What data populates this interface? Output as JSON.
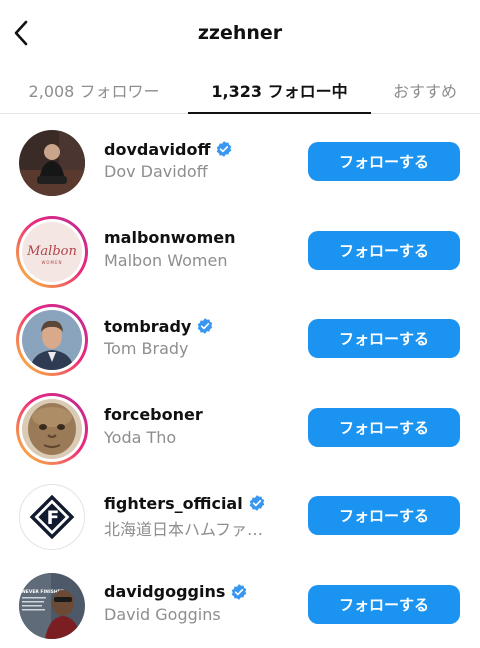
{
  "header": {
    "title": "zzehner",
    "back_icon": "chevron-left-icon"
  },
  "tabs": [
    {
      "label": "2,008 フォロワー",
      "active": false
    },
    {
      "label": "1,323 フォロー中",
      "active": true
    },
    {
      "label": "おすすめ",
      "active": false
    }
  ],
  "accounts": [
    {
      "username": "dovdavidoff",
      "full_name": "Dov Davidoff",
      "verified": true,
      "story_ring": false,
      "avatar": "person-photo",
      "follow_label": "フォローする"
    },
    {
      "username": "malbonwomen",
      "full_name": "Malbon Women",
      "verified": false,
      "story_ring": true,
      "avatar": "malbon-logo",
      "logo_text": "Malbon",
      "logo_sub": "WOMEN",
      "follow_label": "フォローする"
    },
    {
      "username": "tombrady",
      "full_name": "Tom Brady",
      "verified": true,
      "story_ring": true,
      "avatar": "person-photo",
      "follow_label": "フォローする"
    },
    {
      "username": "forceboner",
      "full_name": "Yoda Tho",
      "verified": false,
      "story_ring": true,
      "avatar": "yoda-face",
      "follow_label": "フォローする"
    },
    {
      "username": "fighters_official",
      "full_name": "北海道日本ハムファ…",
      "verified": true,
      "story_ring": false,
      "avatar": "fighters-logo",
      "logo_text": "F",
      "follow_label": "フォローする"
    },
    {
      "username": "davidgoggins",
      "full_name": "David Goggins",
      "verified": true,
      "story_ring": false,
      "avatar": "person-photo",
      "avatar_caption": "NEVER FINISHED",
      "follow_label": "フォローする"
    }
  ],
  "colors": {
    "follow_button": "#1b93f0",
    "verified": "#3897f0",
    "secondary_text": "#8e8e8e"
  }
}
